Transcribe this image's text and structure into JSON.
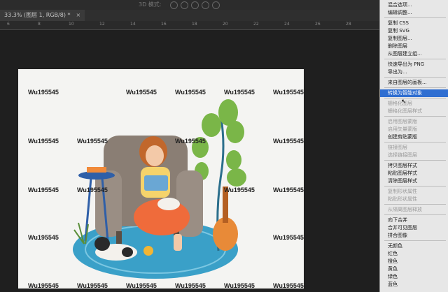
{
  "doc_tab": {
    "label": "33.3% (图层 1, RGB/8) *",
    "close": "×"
  },
  "options_bar": {
    "mode_3d": "3D 模式:"
  },
  "ruler": {
    "ticks": [
      "6",
      "8",
      "10",
      "12",
      "14",
      "16",
      "18",
      "20",
      "22",
      "24",
      "26",
      "28"
    ]
  },
  "watermark": "Wu195545",
  "context_menu": {
    "items": [
      {
        "label": "混合选项...",
        "enabled": true
      },
      {
        "label": "编辑调整...",
        "enabled": true
      },
      {
        "sep": true
      },
      {
        "label": "复制 CSS",
        "enabled": true
      },
      {
        "label": "复制 SVG",
        "enabled": true
      },
      {
        "label": "复制图层...",
        "enabled": true
      },
      {
        "label": "删除图层",
        "enabled": true
      },
      {
        "label": "从图层建立组...",
        "enabled": true
      },
      {
        "sep": true
      },
      {
        "label": "快速导出为 PNG",
        "enabled": true
      },
      {
        "label": "导出为...",
        "enabled": true
      },
      {
        "sep": true
      },
      {
        "label": "来自图层的画板...",
        "enabled": true
      },
      {
        "sep": true
      },
      {
        "label": "转换为智能对象",
        "enabled": true,
        "highlighted": true
      },
      {
        "sep": true
      },
      {
        "label": "栅格化图层",
        "enabled": false
      },
      {
        "label": "栅格化图层样式",
        "enabled": false
      },
      {
        "sep": true
      },
      {
        "label": "启用图层蒙版",
        "enabled": false
      },
      {
        "label": "启用矢量蒙版",
        "enabled": false
      },
      {
        "label": "创建剪贴蒙版",
        "enabled": true
      },
      {
        "sep": true
      },
      {
        "label": "链接图层",
        "enabled": false
      },
      {
        "label": "选择链接图层",
        "enabled": false
      },
      {
        "sep": true
      },
      {
        "label": "拷贝图层样式",
        "enabled": true
      },
      {
        "label": "粘贴图层样式",
        "enabled": true
      },
      {
        "label": "清除图层样式",
        "enabled": true
      },
      {
        "sep": true
      },
      {
        "label": "复制形状属性",
        "enabled": false
      },
      {
        "label": "粘贴形状属性",
        "enabled": false
      },
      {
        "sep": true
      },
      {
        "label": "从隔离图层释放",
        "enabled": false
      },
      {
        "sep": true
      },
      {
        "label": "向下合并",
        "enabled": true
      },
      {
        "label": "合并可见图层",
        "enabled": true
      },
      {
        "label": "拼合图像",
        "enabled": true
      },
      {
        "sep": true
      },
      {
        "label": "无颜色",
        "enabled": true
      },
      {
        "label": "红色",
        "enabled": true
      },
      {
        "label": "橙色",
        "enabled": true
      },
      {
        "label": "黄色",
        "enabled": true
      },
      {
        "label": "绿色",
        "enabled": true
      },
      {
        "label": "蓝色",
        "enabled": true
      }
    ]
  },
  "colors": {
    "highlight": "#2f6ed1",
    "menu_bg": "#e7e7e7",
    "workspace": "#1f1f1f"
  }
}
